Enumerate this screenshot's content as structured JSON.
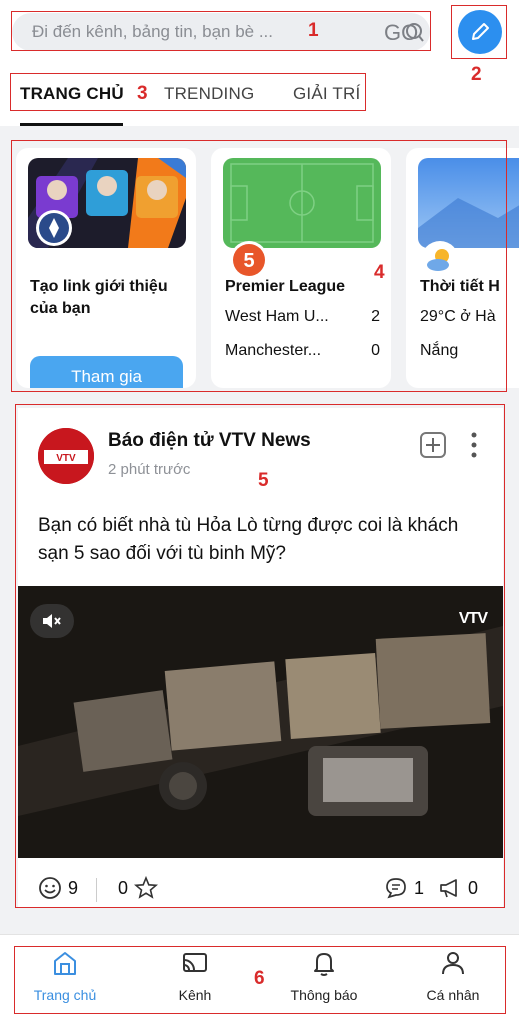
{
  "search": {
    "placeholder": "Đi đến kênh, bảng tin, bạn bè ...",
    "go_label": "GO"
  },
  "tabs": [
    {
      "label": "TRANG CHỦ",
      "active": true
    },
    {
      "label": "TRENDING",
      "active": false
    },
    {
      "label": "GIẢI TRÍ",
      "active": false
    }
  ],
  "cards": {
    "referral": {
      "title": "Tạo link giới thiệu của bạn",
      "button": "Tham gia"
    },
    "football": {
      "badge": "5",
      "title": "Premier League",
      "matches": [
        {
          "team": "West Ham U...",
          "score": "2"
        },
        {
          "team": "Manchester...",
          "score": "0"
        }
      ]
    },
    "weather": {
      "title": "Thời tiết H",
      "temp": "29°C ở Hà",
      "condition": "Nắng"
    }
  },
  "post": {
    "source": "Báo điện tử VTV News",
    "time": "2 phút trước",
    "text": "Bạn có biết nhà tù Hỏa Lò từng được coi là khách sạn 5 sao đối với tù binh Mỹ?",
    "video_logo": "VTV",
    "reactions": "9",
    "stars": "0",
    "comments": "1",
    "shares": "0"
  },
  "bottom_nav": [
    {
      "label": "Trang chủ",
      "icon": "home-icon",
      "active": true
    },
    {
      "label": "Kênh",
      "icon": "cast-icon",
      "active": false
    },
    {
      "label": "Thông báo",
      "icon": "bell-icon",
      "active": false
    },
    {
      "label": "Cá nhân",
      "icon": "person-icon",
      "active": false
    }
  ],
  "annotations": [
    "1",
    "2",
    "3",
    "4",
    "5",
    "6"
  ],
  "colors": {
    "accent": "#2c8fef",
    "annotation": "#d92b2b",
    "field": "#55b85a"
  }
}
